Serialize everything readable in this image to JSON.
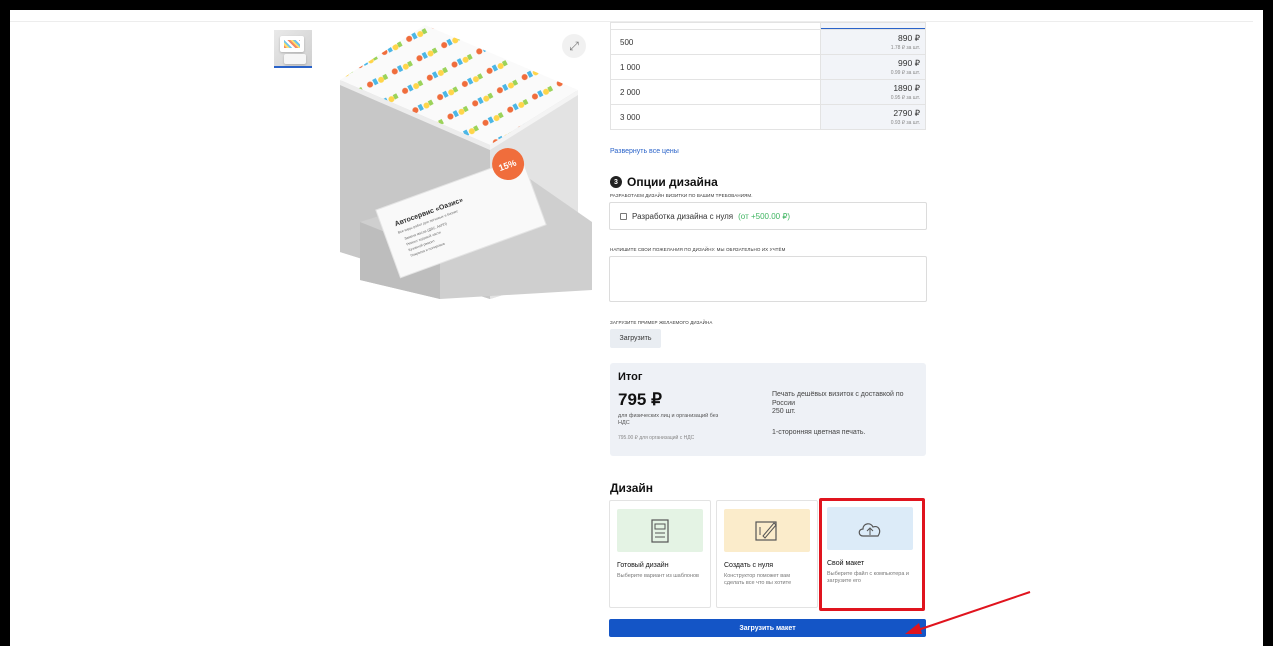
{
  "gallery": {
    "zoom_icon": "expand-icon",
    "card_title": "Автосервис «Оазис»",
    "card_subtitle": "Все виды работ для легковых и бизнес",
    "card_items": [
      "Замена масла (ДВС, АКПП)",
      "Ремонт ходовой части",
      "Кузовной ремонт",
      "Покраска и полировка"
    ],
    "badge": "15%"
  },
  "prices": {
    "rows": [
      {
        "qty": "500",
        "price": "890 ₽",
        "unit": "1.78 ₽ за шт."
      },
      {
        "qty": "1 000",
        "price": "990 ₽",
        "unit": "0.99 ₽ за шт."
      },
      {
        "qty": "2 000",
        "price": "1890 ₽",
        "unit": "0.95 ₽ за шт."
      },
      {
        "qty": "3 000",
        "price": "2790 ₽",
        "unit": "0.93 ₽ за шт."
      }
    ],
    "expand_link": "Развернуть все цены"
  },
  "design_options": {
    "step_number": "3",
    "title": "Опции дизайна",
    "develop_caption": "РАЗРАБОТАЕМ ДИЗАЙН ВИЗИТКИ ПО ВАШИМ ТРЕБОВАНИЯМ.",
    "checkbox_label": "Разработка дизайна с нуля",
    "checkbox_price": "(от +500.00 ₽)",
    "wishes_caption": "НАПИШИТЕ СВОИ ПОЖЕЛАНИЯ ПО ДИЗАЙНУ. МЫ ОБЯЗАТЕЛЬНО ИХ УЧТЁМ",
    "sample_caption": "ЗАГРУЗИТЕ ПРИМЕР ЖЕЛАЕМОГО ДИЗАЙНА",
    "upload_button": "Загрузить"
  },
  "total": {
    "title": "Итог",
    "amount": "795 ₽",
    "note": "для физических лиц и организаций без НДС",
    "vat_note": "795.00 ₽ для организаций с НДС",
    "description": "Печать дешёвых визиток с доставкой по России",
    "quantity": "250 шт.",
    "print_type": "1-сторонняя цветная печать."
  },
  "design": {
    "title": "Дизайн",
    "cards": [
      {
        "name": "Готовый дизайн",
        "sub": "Выберите вариант из шаблонов",
        "icon": "template-icon",
        "color": "#e4f3e4"
      },
      {
        "name": "Создать с нуля",
        "sub": "Конструктор поможет вам сделать все что вы хотите",
        "icon": "constructor-icon",
        "color": "#fbeccb"
      },
      {
        "name": "Свой макет",
        "sub": "Выберите файл с компьютера и загрузите его",
        "icon": "upload-cloud-icon",
        "color": "#dcebf8"
      }
    ],
    "cta": "Загрузить макет"
  }
}
